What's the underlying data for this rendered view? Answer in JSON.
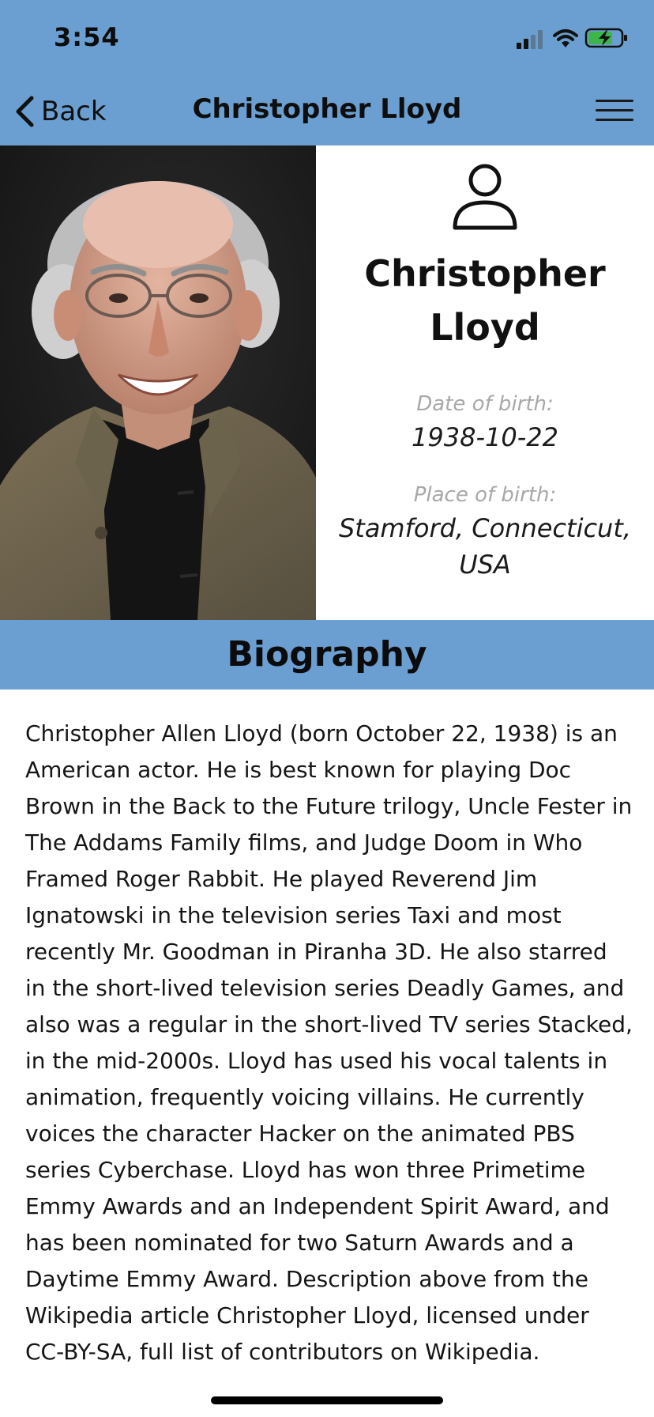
{
  "status_bar": {
    "time": "3:54",
    "icons": [
      "cellular-signal-icon",
      "wifi-icon",
      "battery-charging-icon"
    ]
  },
  "nav": {
    "back_label": "Back",
    "title": "Christopher Lloyd",
    "menu_icon": "hamburger-menu-icon"
  },
  "person": {
    "icon": "person-icon",
    "name_line1": "Christopher",
    "name_line2": "Lloyd",
    "dob_label": "Date of birth:",
    "dob_value": "1938-10-22",
    "pob_label": "Place of birth:",
    "pob_line1": "Stamford, Connecticut,",
    "pob_line2": "USA"
  },
  "biography": {
    "heading": "Biography",
    "text": "Christopher Allen Lloyd (born October 22, 1938) is an American actor. He is best known for playing Doc Brown in the Back to the Future trilogy, Uncle Fester in The Addams Family films, and Judge Doom in Who Framed Roger Rabbit. He played Reverend Jim Ignatowski in the television series Taxi and most recently Mr. Goodman in Piranha 3D. He also starred in the short-lived television series Deadly Games, and also was a regular in the short-lived TV series Stacked, in the mid-2000s. Lloyd has used his vocal talents in animation, frequently voicing villains. He currently voices the character Hacker on the animated PBS series Cyberchase. Lloyd has won three Primetime Emmy Awards and an Independent Spirit Award, and has been nominated for two Saturn Awards and a Daytime Emmy Award. Description above from the Wikipedia article Christopher Lloyd, licensed under CC-BY-SA, full list of contributors on Wikipedia."
  },
  "colors": {
    "accent": "#6b9fd1",
    "background": "#ffffff",
    "label_gray": "#a8a8a8"
  }
}
